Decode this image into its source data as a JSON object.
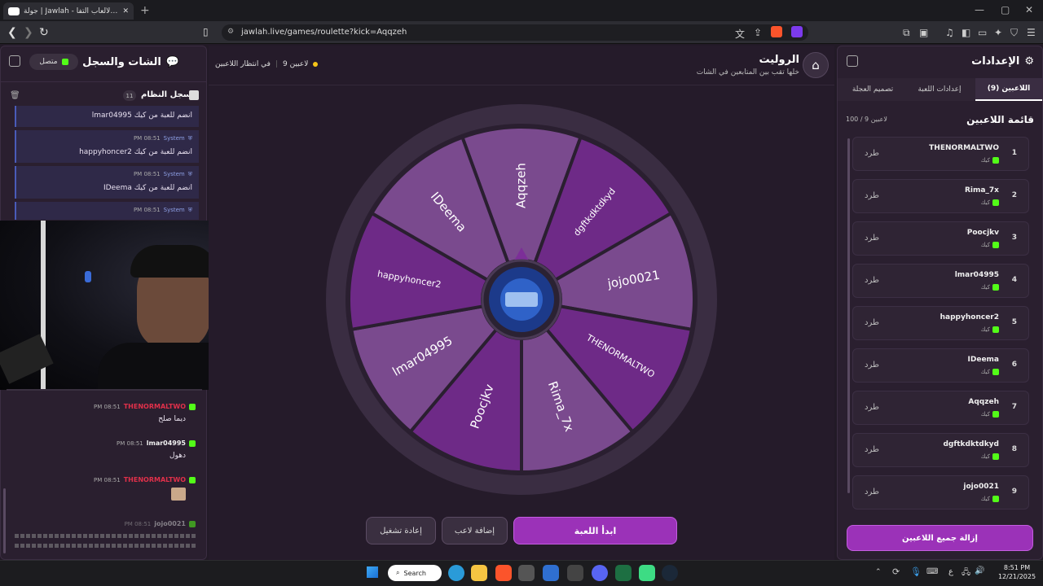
{
  "browser": {
    "tab_title": "جولة | Jawlah - منصة الألعاب التفا",
    "url": "jawlah.live/games/roulette?kick=Aqqzeh"
  },
  "left_panel": {
    "title": "الشات والسجل",
    "status": "متصل",
    "log_title": "سجل النظام",
    "log_count": "11",
    "system_label": "System",
    "sys_messages": [
      {
        "time": "08:51 PM",
        "text": "lmar04995 انضم للعبة من كيك"
      },
      {
        "time": "08:51 PM",
        "text": "happyhoncer2 انضم للعبة من كيك"
      },
      {
        "time": "08:51 PM",
        "text": "IDeema انضم للعبة من كيك"
      },
      {
        "time": "08:51 PM",
        "text": ""
      }
    ],
    "chat": [
      {
        "time": "08:51 PM",
        "user": "THENORMALTWO",
        "text": "ديما صلح",
        "color": "#e0304a"
      },
      {
        "time": "08:51 PM",
        "user": "lmar04995",
        "text": "دهول",
        "color": "#f1f1f1"
      },
      {
        "time": "08:51 PM",
        "user": "THENORMALTWO",
        "text": "",
        "color": "#e0304a"
      },
      {
        "time": "08:51 PM",
        "user": "jojo0021",
        "text": "",
        "color": "#cfcfcf"
      }
    ]
  },
  "center": {
    "title": "الروليت",
    "subtitle": "خلها تقب بين المتابعين في الشات",
    "players_count": "9 لاعبين",
    "waiting": "في انتظار اللاعبين",
    "wheel_segments": [
      "Aqqzeh",
      "dgftkdktdkyd",
      "jojo0021",
      "THENORMALTWO",
      "Rima_7x",
      "Poocjkv",
      "lmar04995",
      "happyhoncer2",
      "IDeema"
    ],
    "start_btn": "ابدأ اللعبة",
    "add_btn": "إضافة لاعب",
    "restart_btn": "إعادة تشغيل",
    "colors": {
      "accent": "#9b32b8",
      "seg_a": "#6e2a87",
      "seg_b": "#7a4a8e"
    }
  },
  "right_panel": {
    "title": "الإعدادات",
    "tabs": [
      "اللاعبين (9)",
      "إعدادات اللعبة",
      "تصميم العجلة"
    ],
    "list_title": "قائمة اللاعبين",
    "list_count": "100 / 9 لاعبين",
    "kick_label": "طرد",
    "platform": "كيك",
    "players": [
      "THENORMALTWO",
      "Rima_7x",
      "Poocjkv",
      "lmar04995",
      "happyhoncer2",
      "IDeema",
      "Aqqzeh",
      "dgftkdktdkyd",
      "jojo0021"
    ],
    "remove_all": "إزالة جميع اللاعبين"
  },
  "taskbar": {
    "search": "Search",
    "time": "8:51 PM",
    "date": "12/21/2025",
    "lang": "ع"
  }
}
